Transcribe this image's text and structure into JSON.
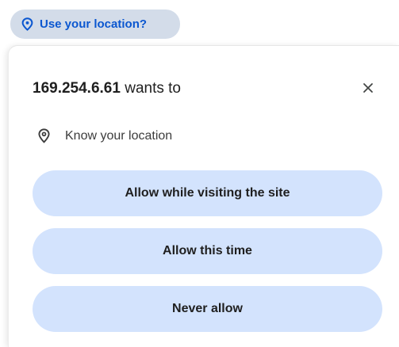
{
  "chip": {
    "label": "Use your location?",
    "icon": "location-pin-icon"
  },
  "dialog": {
    "origin": "169.254.6.61",
    "title_suffix": " wants to",
    "close_icon": "close-icon",
    "permission": {
      "icon": "location-pin-icon",
      "label": "Know your location"
    },
    "buttons": {
      "allow_while_visiting": "Allow while visiting the site",
      "allow_this_time": "Allow this time",
      "never_allow": "Never allow"
    }
  },
  "colors": {
    "chip_bg": "#d3dce9",
    "chip_text": "#0b57d0",
    "button_bg": "#d3e3fd",
    "text": "#1f1f1f"
  }
}
